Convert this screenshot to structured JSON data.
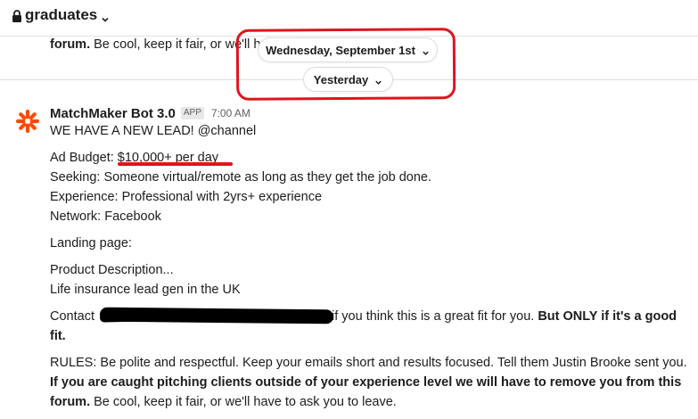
{
  "channel": {
    "name": "graduates"
  },
  "previous_message": {
    "bold": "forum.",
    "text": " Be cool, keep it fair, or we'll h"
  },
  "date_pills": {
    "first": "Wednesday, September 1st",
    "second": "Yesterday"
  },
  "message": {
    "author": "MatchMaker Bot 3.0",
    "badge": "APP",
    "time": "7:00 AM",
    "headline": "WE HAVE A NEW LEAD! @channel",
    "ad_budget_label": "Ad Budget: ",
    "ad_budget_value": "$10,000+ per day",
    "seeking": "Seeking: Someone virtual/remote as long as they get the job done.",
    "experience": "Experience: Professional with 2yrs+ experience",
    "network": "Network: Facebook",
    "landing_page": "Landing page:",
    "product_description": "Product Description...",
    "product_detail": "Life insurance lead gen in the UK",
    "contact_prefix": "Contact ",
    "contact_suffix": " if you think this is a great fit for you. ",
    "contact_bold": "But ONLY if it's a good fit.",
    "rules_text": "RULES: Be polite and respectful. Keep your emails short and results focused. Tell them Justin Brooke sent you. ",
    "rules_bold": "If you are caught pitching clients outside of your experience level we will have to remove you from this forum.",
    "rules_end": " Be cool, keep it fair, or we'll have to ask you to leave."
  },
  "colors": {
    "annotation_red": "#e0141b",
    "avatar_orange": "#ff4a00",
    "redaction": "#000000"
  },
  "icons": {
    "channel": "lock-icon",
    "dropdown": "chevron-down-icon",
    "avatar": "zapier-asterisk-icon"
  }
}
